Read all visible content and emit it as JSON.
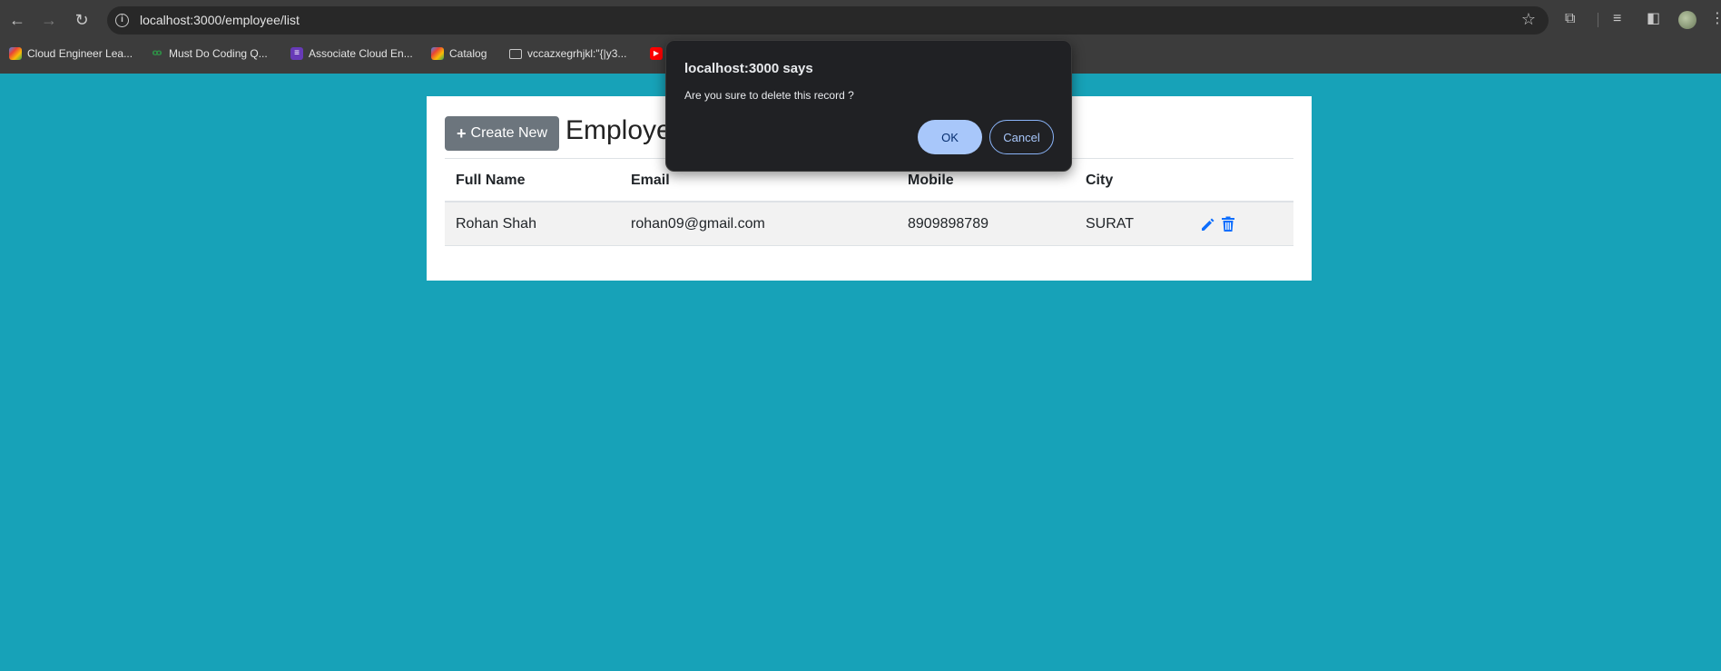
{
  "browser": {
    "url": "localhost:3000/employee/list",
    "bookmarks": [
      {
        "label": "Cloud Engineer Lea...",
        "icon": "google-cloud-icon"
      },
      {
        "label": "Must Do Coding Q...",
        "icon": "gfg-icon"
      },
      {
        "label": "Associate Cloud En...",
        "icon": "list-icon"
      },
      {
        "label": "Catalog",
        "icon": "google-cloud-icon"
      },
      {
        "label": "vccazxegrhjkl:\"{|y3...",
        "icon": "folder-icon"
      }
    ]
  },
  "page": {
    "create_label": "Create New",
    "title": "Employe",
    "table": {
      "headers": [
        "Full Name",
        "Email",
        "Mobile",
        "City"
      ],
      "rows": [
        {
          "name": "Rohan Shah",
          "email": "rohan09@gmail.com",
          "mobile": "8909898789",
          "city": "SURAT"
        }
      ]
    }
  },
  "dialog": {
    "title": "localhost:3000 says",
    "message": "Are you sure to delete this record ?",
    "ok_label": "OK",
    "cancel_label": "Cancel"
  },
  "colors": {
    "page_bg": "#17a2b8",
    "create_button": "#6c757d",
    "action_icon": "#0d6efd",
    "ok_button": "#a8c7fa"
  }
}
